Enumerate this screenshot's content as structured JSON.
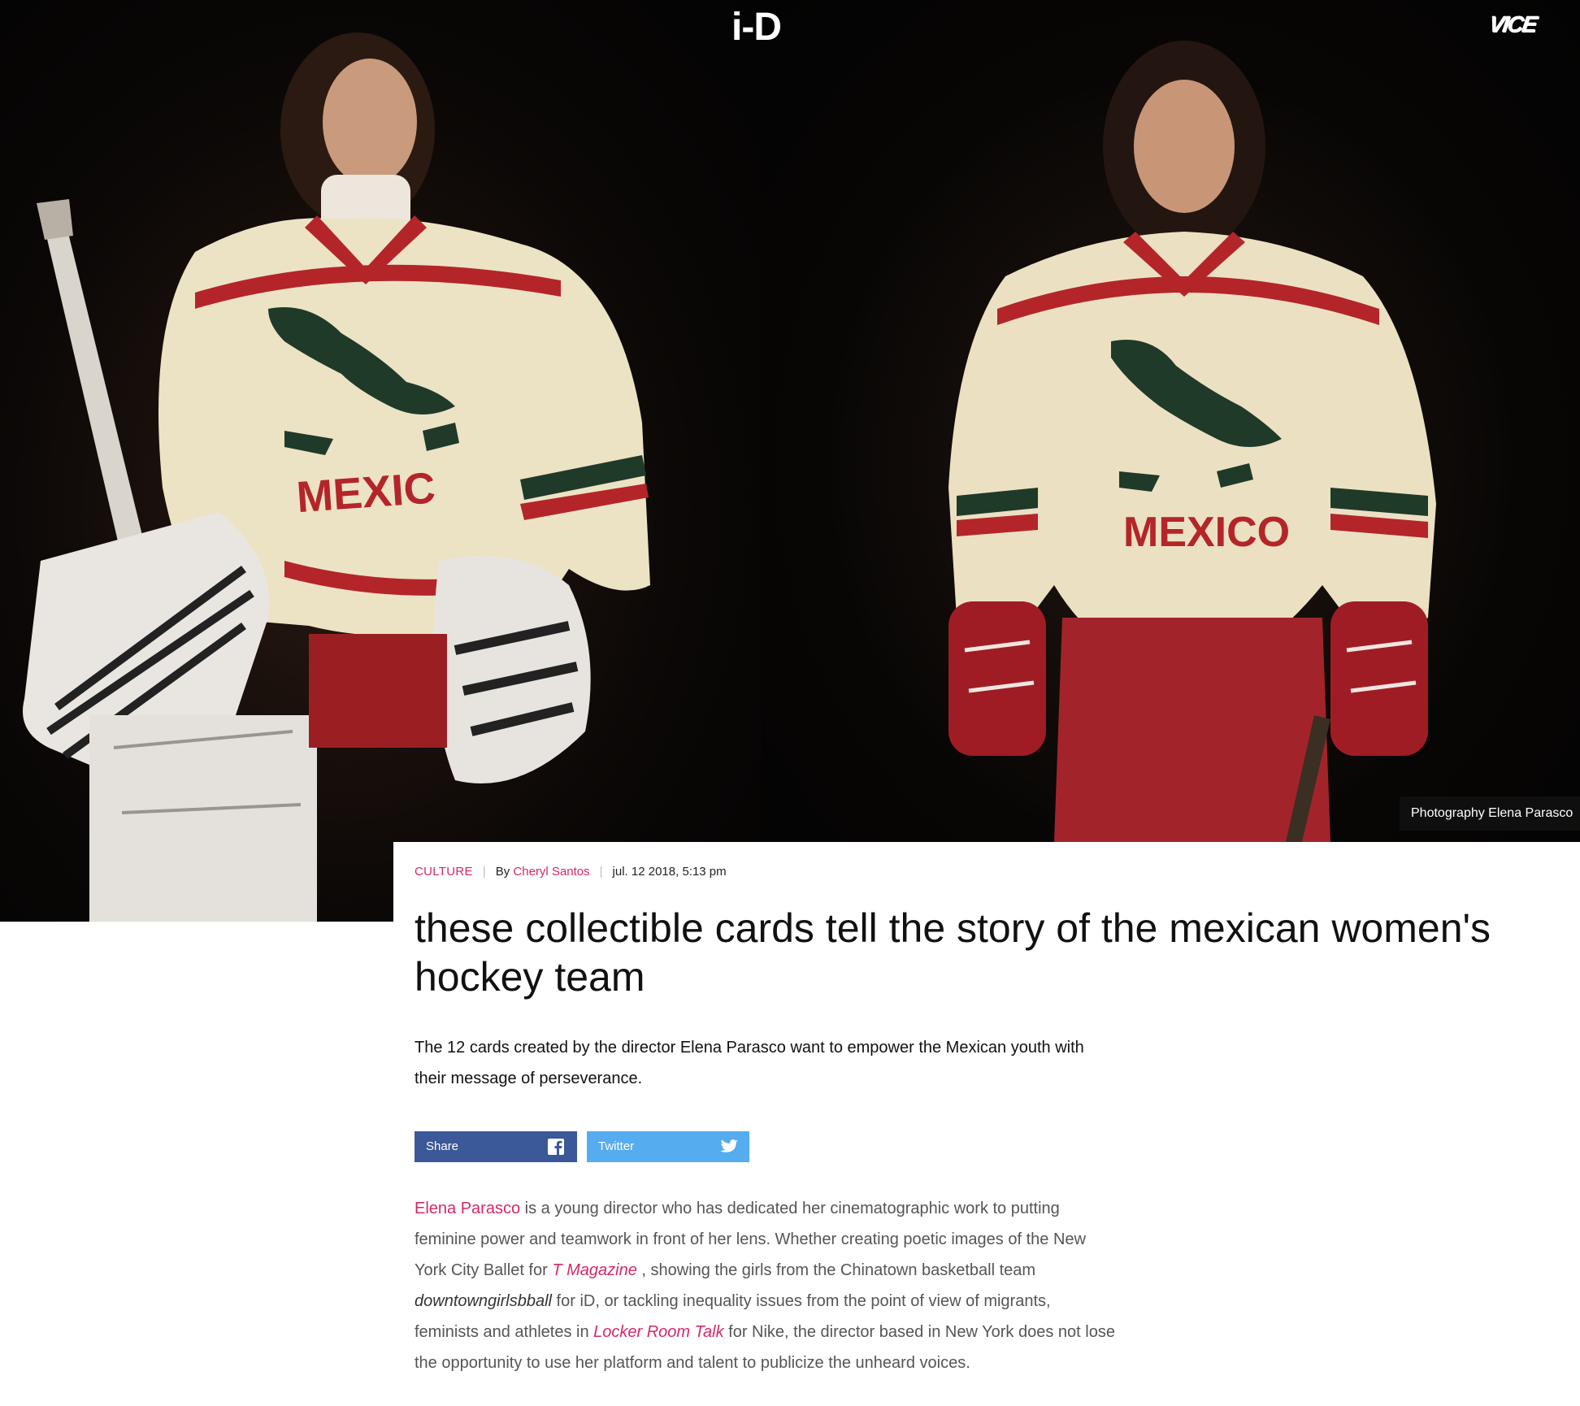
{
  "header": {
    "logo": "i-D",
    "brand_logo": "VICE"
  },
  "hero": {
    "photo_credit": "Photography Elena Parasco",
    "jersey_text_left": "MEXIC",
    "jersey_text_right": "MEXICO"
  },
  "article": {
    "category": "CULTURE",
    "by_label": "By",
    "author": "Cheryl Santos",
    "date": "jul. 12 2018, 5:13 pm",
    "headline": "these collectible cards tell the story of the mexican women's hockey team",
    "dek": "The 12 cards created by the director Elena Parasco want to empower the Mexican youth with their message of perseverance.",
    "share": {
      "facebook_label": "Share",
      "twitter_label": "Twitter"
    },
    "body": {
      "link_name": "Elena Parasco",
      "p1": " is a young director who has dedicated her cinematographic work to putting feminine power and teamwork in front of her lens. Whether creating poetic images of the New York City Ballet for ",
      "link_tmag": "T Magazine",
      "p2": " , showing the girls from the Chinatown basketball team ",
      "em_dgb": "downtowngirlsbball",
      "p3": " for iD, or tackling inequality issues from the point of view of migrants, feminists and athletes in ",
      "link_locker": "Locker Room Talk",
      "p4": " for Nike, the director based in New York does not lose the opportunity to use her platform and talent to publicize the unheard voices."
    }
  },
  "colors": {
    "accent": "#d4286a",
    "facebook": "#3b5998",
    "twitter": "#55acee"
  }
}
